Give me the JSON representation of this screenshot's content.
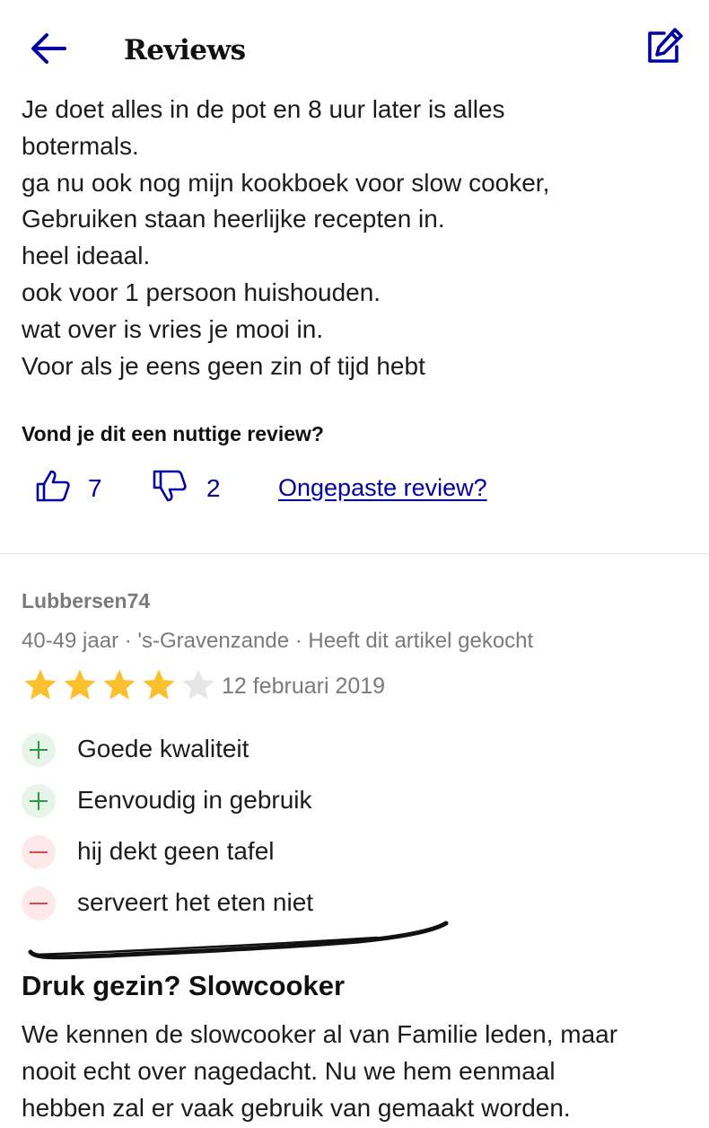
{
  "header": {
    "title": "Reviews",
    "back_icon": "arrow-left-icon",
    "edit_icon": "edit-icon",
    "accent_color": "#0000a4"
  },
  "review_1": {
    "body_lines": [
      "Je doet alles in de pot en 8 uur later is alles",
      "botermals.",
      "ga nu ook nog mijn kookboek voor slow cooker,",
      "Gebruiken staan heerlijke recepten in.",
      "heel ideaal.",
      "ook voor 1 persoon huishouden.",
      "wat over is vries je mooi in.",
      "Voor als je eens geen zin of tijd hebt"
    ],
    "helpful_question": "Vond je dit een nuttige review?",
    "thumbs_up_count": "7",
    "thumbs_down_count": "2",
    "report_link": "Ongepaste review?"
  },
  "review_2": {
    "reviewer": "Lubbersen74",
    "meta": "40-49 jaar · 's-Gravenzande · Heeft dit artikel gekocht",
    "rating": 4,
    "rating_max": 5,
    "date": "12 februari 2019",
    "pros_cons": [
      {
        "type": "pro",
        "text": "Goede kwaliteit"
      },
      {
        "type": "pro",
        "text": "Eenvoudig in gebruik"
      },
      {
        "type": "con",
        "text": "hij dekt geen tafel"
      },
      {
        "type": "con",
        "text": "serveert het eten niet"
      }
    ],
    "title": "Druk gezin? Slowcooker",
    "body_lines": [
      "We kennen de slowcooker al van Familie leden, maar",
      "nooit echt over nagedacht. Nu we hem eenmaal",
      "hebben zal er vaak gebruik van gemaakt worden."
    ]
  },
  "colors": {
    "star_filled": "#fbc02d",
    "star_empty": "#e6e6e6",
    "pro": "#2b9a3e",
    "con": "#e0434c"
  }
}
